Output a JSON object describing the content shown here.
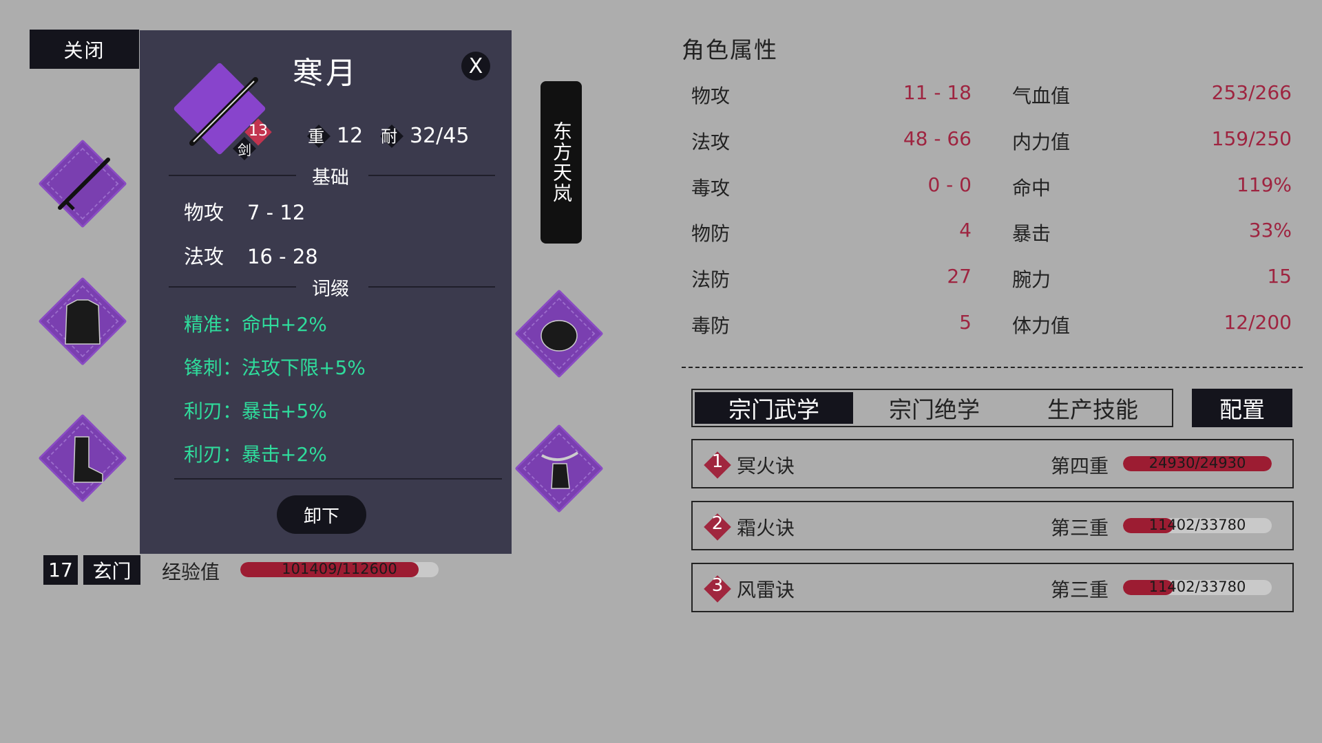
{
  "close_label": "关闭",
  "item_tooltip": {
    "name": "寒月",
    "close_label": "X",
    "level_badge": "13",
    "type_badge": "剑",
    "weight_icon": "重",
    "weight": "12",
    "durability_icon": "耐",
    "durability": "32/45",
    "base_header": "基础",
    "base_stats": [
      {
        "label": "物攻",
        "value": "7 - 12"
      },
      {
        "label": "法攻",
        "value": "16 - 28"
      }
    ],
    "affix_header": "词缀",
    "affixes": [
      "精准：命中+2%",
      "锋刺：法攻下限+5%",
      "利刃：暴击+5%",
      "利刃：暴击+2%"
    ],
    "unequip_label": "卸下"
  },
  "character": {
    "level": "17",
    "sect": "玄门",
    "name": "东方天岚",
    "exp_label": "经验值",
    "exp_text": "101409/112600",
    "exp_fraction": 0.9006
  },
  "equipment_slots": [
    {
      "slot": "weapon",
      "icon": "sword-icon"
    },
    {
      "slot": "armor",
      "icon": "robe-icon"
    },
    {
      "slot": "boots",
      "icon": "boot-icon"
    },
    {
      "slot": "accessory",
      "icon": "stone-icon"
    },
    {
      "slot": "accessory2",
      "icon": "pouch-icon"
    }
  ],
  "attributes": {
    "title": "角色属性",
    "left": [
      {
        "label": "物攻",
        "value": "11 - 18"
      },
      {
        "label": "法攻",
        "value": "48 - 66"
      },
      {
        "label": "毒攻",
        "value": "0 - 0"
      },
      {
        "label": "物防",
        "value": "4"
      },
      {
        "label": "法防",
        "value": "27"
      },
      {
        "label": "毒防",
        "value": "5"
      }
    ],
    "right": [
      {
        "label": "气血值",
        "value": "253/266"
      },
      {
        "label": "内力值",
        "value": "159/250"
      },
      {
        "label": "命中",
        "value": "119%"
      },
      {
        "label": "暴击",
        "value": "33%"
      },
      {
        "label": "腕力",
        "value": "15"
      },
      {
        "label": "体力值",
        "value": "12/200"
      }
    ]
  },
  "tabs": [
    "宗门武学",
    "宗门绝学",
    "生产技能"
  ],
  "config_label": "配置",
  "skills": [
    {
      "num": "1",
      "name": "冥火诀",
      "stage": "第四重",
      "progress": "24930/24930",
      "fraction": 1.0
    },
    {
      "num": "2",
      "name": "霜火诀",
      "stage": "第三重",
      "progress": "11402/33780",
      "fraction": 0.3375
    },
    {
      "num": "3",
      "name": "风雷诀",
      "stage": "第三重",
      "progress": "11402/33780",
      "fraction": 0.3375
    }
  ],
  "colors": {
    "accent_red": "#9e2440",
    "affix_green": "#2fdc9c",
    "slot_purple": "#7a3fb0",
    "panel_bg": "#3b3a4d"
  }
}
